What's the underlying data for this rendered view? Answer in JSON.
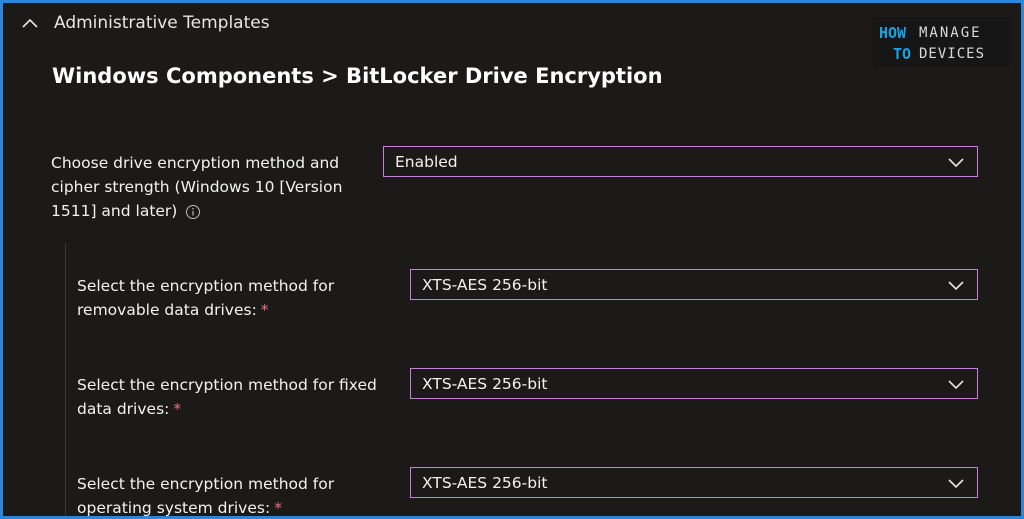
{
  "section": {
    "title": "Administrative Templates"
  },
  "page": {
    "title": "Windows Components > BitLocker Drive Encryption"
  },
  "logo": {
    "line1a": "HOW",
    "line1b": "MANAGE",
    "line2a": "TO",
    "line2b": "DEVICES"
  },
  "settings": [
    {
      "label_lines": [
        "Choose drive encryption method and",
        "cipher strength (Windows 10 [Version",
        "1511] and later)"
      ],
      "value": "Enabled",
      "info_icon": "info-icon"
    },
    {
      "label_lines": [
        "Select the encryption method for",
        "removable data drives:"
      ],
      "required": "*",
      "value": "XTS-AES 256-bit"
    },
    {
      "label_lines": [
        "Select the encryption method for fixed",
        "data drives:"
      ],
      "required": "*",
      "value": "XTS-AES 256-bit"
    },
    {
      "label_lines": [
        "Select the encryption method for",
        "operating system drives:"
      ],
      "required": "*",
      "value": "XTS-AES 256-bit"
    }
  ],
  "colors": {
    "accent_border": "#c580d9",
    "frame": "#2f86d6",
    "required": "#f1707b",
    "logo_blue": "#1ba0e2"
  }
}
